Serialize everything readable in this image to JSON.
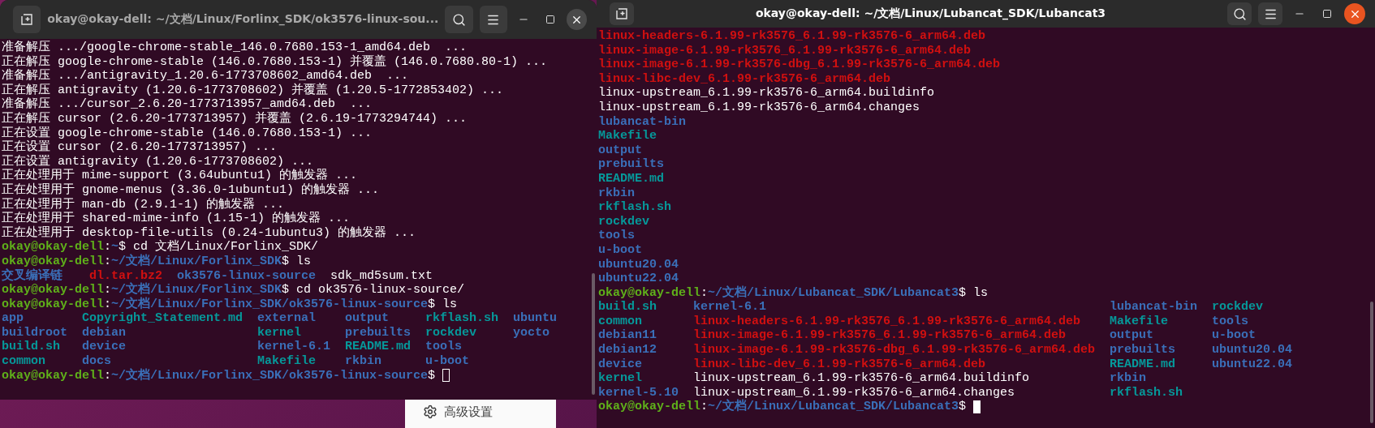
{
  "terminals": [
    {
      "title": "okay@okay-dell: ~/文档/Linux/Forlinx_SDK/ok3576-linux-sou...",
      "focused": false,
      "lines": [
        {
          "kind": "output",
          "text": "准备解压 .../google-chrome-stable_146.0.7680.153-1_amd64.deb  ..."
        },
        {
          "kind": "output",
          "text": "正在解压 google-chrome-stable (146.0.7680.153-1) 并覆盖 (146.0.7680.80-1) ..."
        },
        {
          "kind": "output",
          "text": "准备解压 .../antigravity_1.20.6-1773708602_amd64.deb  ..."
        },
        {
          "kind": "output",
          "text": "正在解压 antigravity (1.20.6-1773708602) 并覆盖 (1.20.5-1772853402) ..."
        },
        {
          "kind": "output",
          "text": "准备解压 .../cursor_2.6.20-1773713957_amd64.deb  ..."
        },
        {
          "kind": "output",
          "text": "正在解压 cursor (2.6.20-1773713957) 并覆盖 (2.6.19-1773294744) ..."
        },
        {
          "kind": "output",
          "text": "正在设置 google-chrome-stable (146.0.7680.153-1) ..."
        },
        {
          "kind": "output",
          "text": "正在设置 cursor (2.6.20-1773713957) ..."
        },
        {
          "kind": "output",
          "text": "正在设置 antigravity (1.20.6-1773708602) ..."
        },
        {
          "kind": "output",
          "text": "正在处理用于 mime-support (3.64ubuntu1) 的触发器 ..."
        },
        {
          "kind": "output",
          "text": "正在处理用于 gnome-menus (3.36.0-1ubuntu1) 的触发器 ..."
        },
        {
          "kind": "output",
          "text": "正在处理用于 man-db (2.9.1-1) 的触发器 ..."
        },
        {
          "kind": "output",
          "text": "正在处理用于 shared-mime-info (1.15-1) 的触发器 ..."
        },
        {
          "kind": "output",
          "text": "正在处理用于 desktop-file-utils (0.24-1ubuntu3) 的触发器 ..."
        },
        {
          "kind": "prompt",
          "user": "okay@okay-dell",
          "separator": ":",
          "path": "~",
          "command": "$ cd 文档/Linux/Forlinx_SDK/"
        },
        {
          "kind": "prompt",
          "user": "okay@okay-dell",
          "separator": ":",
          "path": "~/文档/Linux/Forlinx_SDK",
          "command": "$ ls"
        },
        {
          "kind": "listing",
          "rows": [
            [
              {
                "name": "交叉编译链",
                "kind": "dir"
              },
              {
                "name": "dl.tar.bz2",
                "kind": "archive"
              },
              {
                "name": "ok3576-linux-source",
                "kind": "dir"
              },
              {
                "name": "sdk_md5sum.txt",
                "kind": "file"
              }
            ]
          ]
        },
        {
          "kind": "prompt",
          "user": "okay@okay-dell",
          "separator": ":",
          "path": "~/文档/Linux/Forlinx_SDK",
          "command": "$ cd ok3576-linux-source/"
        },
        {
          "kind": "prompt",
          "user": "okay@okay-dell",
          "separator": ":",
          "path": "~/文档/Linux/Forlinx_SDK/ok3576-linux-source",
          "command": "$ ls"
        },
        {
          "kind": "listing",
          "rows": [
            [
              {
                "name": "app",
                "kind": "dir"
              },
              {
                "name": "Copyright_Statement.md",
                "kind": "link"
              },
              {
                "name": "external",
                "kind": "dir"
              },
              {
                "name": "output",
                "kind": "dir"
              },
              {
                "name": "rkflash.sh",
                "kind": "link"
              },
              {
                "name": "ubuntu",
                "kind": "dir"
              }
            ],
            [
              {
                "name": "buildroot",
                "kind": "dir"
              },
              {
                "name": "debian",
                "kind": "dir"
              },
              {
                "name": "kernel",
                "kind": "link"
              },
              {
                "name": "prebuilts",
                "kind": "dir"
              },
              {
                "name": "rockdev",
                "kind": "link"
              },
              {
                "name": "yocto",
                "kind": "dir"
              }
            ],
            [
              {
                "name": "build.sh",
                "kind": "link"
              },
              {
                "name": "device",
                "kind": "dir"
              },
              {
                "name": "kernel-6.1",
                "kind": "dir"
              },
              {
                "name": "README.md",
                "kind": "link"
              },
              {
                "name": "tools",
                "kind": "dir"
              }
            ],
            [
              {
                "name": "common",
                "kind": "link"
              },
              {
                "name": "docs",
                "kind": "dir"
              },
              {
                "name": "Makefile",
                "kind": "link"
              },
              {
                "name": "rkbin",
                "kind": "dir"
              },
              {
                "name": "u-boot",
                "kind": "dir"
              }
            ]
          ]
        },
        {
          "kind": "prompt",
          "user": "okay@okay-dell",
          "separator": ":",
          "path": "~/文档/Linux/Forlinx_SDK/ok3576-linux-source",
          "command": "$",
          "cursor": true
        }
      ]
    },
    {
      "title": "okay@okay-dell: ~/文档/Linux/Lubancat_SDK/Lubancat3",
      "focused": true,
      "lines": [
        {
          "kind": "listing",
          "rows": [
            [
              {
                "name": "linux-headers-6.1.99-rk3576_6.1.99-rk3576-6_arm64.deb",
                "kind": "archive"
              }
            ],
            [
              {
                "name": "linux-image-6.1.99-rk3576_6.1.99-rk3576-6_arm64.deb",
                "kind": "archive"
              }
            ],
            [
              {
                "name": "linux-image-6.1.99-rk3576-dbg_6.1.99-rk3576-6_arm64.deb",
                "kind": "archive"
              }
            ],
            [
              {
                "name": "linux-libc-dev_6.1.99-rk3576-6_arm64.deb",
                "kind": "archive"
              }
            ],
            [
              {
                "name": "linux-upstream_6.1.99-rk3576-6_arm64.buildinfo",
                "kind": "file"
              }
            ],
            [
              {
                "name": "linux-upstream_6.1.99-rk3576-6_arm64.changes",
                "kind": "file"
              }
            ],
            [
              {
                "name": "lubancat-bin",
                "kind": "dir"
              }
            ],
            [
              {
                "name": "Makefile",
                "kind": "link"
              }
            ],
            [
              {
                "name": "output",
                "kind": "dir"
              }
            ],
            [
              {
                "name": "prebuilts",
                "kind": "dir"
              }
            ],
            [
              {
                "name": "README.md",
                "kind": "link"
              }
            ],
            [
              {
                "name": "rkbin",
                "kind": "dir"
              }
            ],
            [
              {
                "name": "rkflash.sh",
                "kind": "link"
              }
            ],
            [
              {
                "name": "rockdev",
                "kind": "link"
              }
            ],
            [
              {
                "name": "tools",
                "kind": "dir"
              }
            ],
            [
              {
                "name": "u-boot",
                "kind": "dir"
              }
            ],
            [
              {
                "name": "ubuntu20.04",
                "kind": "dir"
              }
            ],
            [
              {
                "name": "ubuntu22.04",
                "kind": "dir"
              }
            ]
          ]
        },
        {
          "kind": "prompt",
          "user": "okay@okay-dell",
          "separator": ":",
          "path": "~/文档/Linux/Lubancat_SDK/Lubancat3",
          "command": "$ ls"
        },
        {
          "kind": "listing",
          "rows": [
            [
              {
                "name": "build.sh",
                "kind": "link"
              },
              {
                "name": "kernel-6.1",
                "kind": "dir"
              },
              {
                "name": "lubancat-bin",
                "kind": "dir"
              },
              {
                "name": "rockdev",
                "kind": "link"
              }
            ],
            [
              {
                "name": "common",
                "kind": "link"
              },
              {
                "name": "linux-headers-6.1.99-rk3576_6.1.99-rk3576-6_arm64.deb",
                "kind": "archive"
              },
              {
                "name": "Makefile",
                "kind": "link"
              },
              {
                "name": "tools",
                "kind": "dir"
              }
            ],
            [
              {
                "name": "debian11",
                "kind": "dir"
              },
              {
                "name": "linux-image-6.1.99-rk3576_6.1.99-rk3576-6_arm64.deb",
                "kind": "archive"
              },
              {
                "name": "output",
                "kind": "dir"
              },
              {
                "name": "u-boot",
                "kind": "dir"
              }
            ],
            [
              {
                "name": "debian12",
                "kind": "dir"
              },
              {
                "name": "linux-image-6.1.99-rk3576-dbg_6.1.99-rk3576-6_arm64.deb",
                "kind": "archive"
              },
              {
                "name": "prebuilts",
                "kind": "dir"
              },
              {
                "name": "ubuntu20.04",
                "kind": "dir"
              }
            ],
            [
              {
                "name": "device",
                "kind": "dir"
              },
              {
                "name": "linux-libc-dev_6.1.99-rk3576-6_arm64.deb",
                "kind": "archive"
              },
              {
                "name": "README.md",
                "kind": "link"
              },
              {
                "name": "ubuntu22.04",
                "kind": "dir"
              }
            ],
            [
              {
                "name": "kernel",
                "kind": "link"
              },
              {
                "name": "linux-upstream_6.1.99-rk3576-6_arm64.buildinfo",
                "kind": "file"
              },
              {
                "name": "rkbin",
                "kind": "dir"
              }
            ],
            [
              {
                "name": "kernel-5.10",
                "kind": "dir"
              },
              {
                "name": "linux-upstream_6.1.99-rk3576-6_arm64.changes",
                "kind": "file"
              },
              {
                "name": "rkflash.sh",
                "kind": "link"
              }
            ]
          ]
        },
        {
          "kind": "prompt",
          "user": "okay@okay-dell",
          "separator": ":",
          "path": "~/文档/Linux/Lubancat_SDK/Lubancat3",
          "command": "$",
          "cursor": true
        }
      ]
    }
  ],
  "background_window": {
    "item": "高级设置"
  }
}
